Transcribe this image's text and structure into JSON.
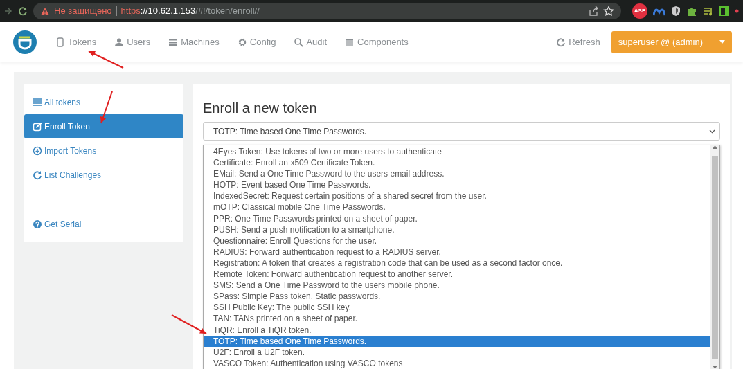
{
  "browser": {
    "security_label": "Не защищено",
    "url_scheme": "https",
    "url_host": "://10.62.1.153",
    "url_path": "/#!/token/enroll//",
    "extension_badge": "ASP"
  },
  "navbar": {
    "items": [
      {
        "label": "Tokens"
      },
      {
        "label": "Users"
      },
      {
        "label": "Machines"
      },
      {
        "label": "Config"
      },
      {
        "label": "Audit"
      },
      {
        "label": "Components"
      }
    ],
    "refresh": "Refresh",
    "user_menu": "superuser @ (admin)"
  },
  "sidebar": {
    "items": [
      {
        "label": "All tokens",
        "selected": false
      },
      {
        "label": "Enroll Token",
        "selected": true
      },
      {
        "label": "Import Tokens",
        "selected": false
      },
      {
        "label": "List Challenges",
        "selected": false
      },
      {
        "label": "Get Serial",
        "selected": false
      }
    ]
  },
  "main": {
    "title": "Enroll a new token",
    "select_value": "TOTP: Time based One Time Passwords.",
    "options": [
      {
        "label": "4Eyes Token: Use tokens of two or more users to authenticate",
        "selected": false
      },
      {
        "label": "Certificate: Enroll an x509 Certificate Token.",
        "selected": false
      },
      {
        "label": "EMail: Send a One Time Password to the users email address.",
        "selected": false
      },
      {
        "label": "HOTP: Event based One Time Passwords.",
        "selected": false
      },
      {
        "label": "IndexedSecret: Request certain positions of a shared secret from the user.",
        "selected": false
      },
      {
        "label": "mOTP: Classical mobile One Time Passwords.",
        "selected": false
      },
      {
        "label": "PPR: One Time Passwords printed on a sheet of paper.",
        "selected": false
      },
      {
        "label": "PUSH: Send a push notification to a smartphone.",
        "selected": false
      },
      {
        "label": "Questionnaire: Enroll Questions for the user.",
        "selected": false
      },
      {
        "label": "RADIUS: Forward authentication request to a RADIUS server.",
        "selected": false
      },
      {
        "label": "Registration: A token that creates a registration code that can be used as a second factor once.",
        "selected": false
      },
      {
        "label": "Remote Token: Forward authentication request to another server.",
        "selected": false
      },
      {
        "label": "SMS: Send a One Time Password to the users mobile phone.",
        "selected": false
      },
      {
        "label": "SPass: Simple Pass token. Static passwords.",
        "selected": false
      },
      {
        "label": "SSH Public Key: The public SSH key.",
        "selected": false
      },
      {
        "label": "TAN: TANs printed on a sheet of paper.",
        "selected": false
      },
      {
        "label": "TiQR: Enroll a TiQR token.",
        "selected": false
      },
      {
        "label": "TOTP: Time based One Time Passwords.",
        "selected": true
      },
      {
        "label": "U2F: Enroll a U2F token.",
        "selected": false
      },
      {
        "label": "VASCO Token: Authentication using VASCO tokens",
        "selected": false
      }
    ]
  }
}
